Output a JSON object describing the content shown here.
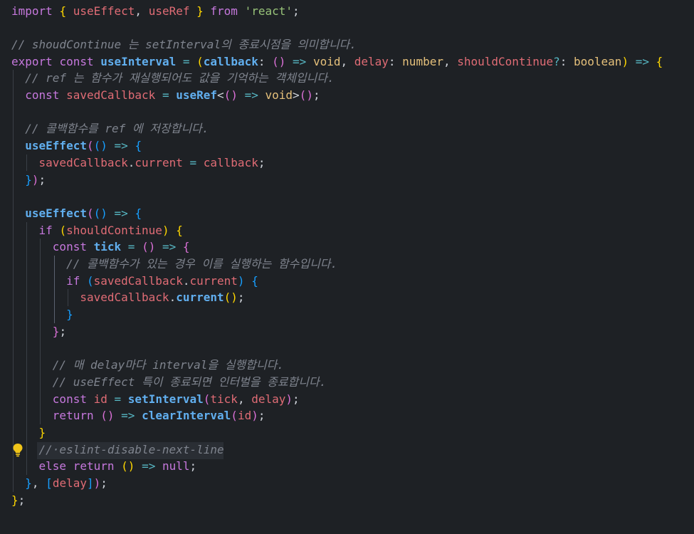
{
  "editor": {
    "colors": {
      "background": "#1e2125",
      "keyword": "#c678dd",
      "function": "#61afef",
      "variable": "#e06c75",
      "type": "#e5c07b",
      "string": "#98c379",
      "comment": "#7f848e",
      "bracket_1": "#ffd700",
      "bracket_2": "#da70d6",
      "bracket_3": "#179fff"
    },
    "lightbulb_icon": "lightbulb-icon",
    "lines": [
      [
        [
          "kw",
          "import"
        ],
        [
          "p",
          " "
        ],
        [
          "b1",
          "{"
        ],
        [
          "p",
          " "
        ],
        [
          "var",
          "useEffect"
        ],
        [
          "p",
          ", "
        ],
        [
          "var",
          "useRef"
        ],
        [
          "p",
          " "
        ],
        [
          "b1",
          "}"
        ],
        [
          "p",
          " "
        ],
        [
          "kw",
          "from"
        ],
        [
          "p",
          " "
        ],
        [
          "str",
          "'react'"
        ],
        [
          "p",
          ";"
        ]
      ],
      [],
      [
        [
          "com",
          "// shoudContinue 는 setInterval의 종료시점을 의미합니다."
        ]
      ],
      [
        [
          "kw",
          "export"
        ],
        [
          "p",
          " "
        ],
        [
          "kw",
          "const"
        ],
        [
          "p",
          " "
        ],
        [
          "fn",
          "useInterval"
        ],
        [
          "p",
          " "
        ],
        [
          "op",
          "="
        ],
        [
          "p",
          " "
        ],
        [
          "b1",
          "("
        ],
        [
          "fnp",
          "callback"
        ],
        [
          "p",
          ": "
        ],
        [
          "b2",
          "("
        ],
        [
          "b2",
          ")"
        ],
        [
          "p",
          " "
        ],
        [
          "op",
          "=>"
        ],
        [
          "p",
          " "
        ],
        [
          "type",
          "void"
        ],
        [
          "p",
          ", "
        ],
        [
          "var",
          "delay"
        ],
        [
          "p",
          ": "
        ],
        [
          "type",
          "number"
        ],
        [
          "p",
          ", "
        ],
        [
          "var",
          "shouldContinue"
        ],
        [
          "op",
          "?"
        ],
        [
          "p",
          ": "
        ],
        [
          "type",
          "boolean"
        ],
        [
          "b1",
          ")"
        ],
        [
          "p",
          " "
        ],
        [
          "op",
          "=>"
        ],
        [
          "p",
          " "
        ],
        [
          "b1",
          "{"
        ]
      ],
      [
        [
          "p",
          "  "
        ],
        [
          "com",
          "// ref 는 함수가 재실행되어도 값을 기억하는 객체입니다."
        ]
      ],
      [
        [
          "p",
          "  "
        ],
        [
          "kw",
          "const"
        ],
        [
          "p",
          " "
        ],
        [
          "var",
          "savedCallback"
        ],
        [
          "p",
          " "
        ],
        [
          "op",
          "="
        ],
        [
          "p",
          " "
        ],
        [
          "fn",
          "useRef"
        ],
        [
          "p",
          "<"
        ],
        [
          "b2",
          "("
        ],
        [
          "b2",
          ")"
        ],
        [
          "p",
          " "
        ],
        [
          "op",
          "=>"
        ],
        [
          "p",
          " "
        ],
        [
          "type",
          "void"
        ],
        [
          "p",
          ">"
        ],
        [
          "b2",
          "("
        ],
        [
          "b2",
          ")"
        ],
        [
          "p",
          ";"
        ]
      ],
      [],
      [
        [
          "p",
          "  "
        ],
        [
          "com",
          "// 콜백함수를 ref 에 저장합니다."
        ]
      ],
      [
        [
          "p",
          "  "
        ],
        [
          "fn",
          "useEffect"
        ],
        [
          "b2",
          "("
        ],
        [
          "b3",
          "("
        ],
        [
          "b3",
          ")"
        ],
        [
          "p",
          " "
        ],
        [
          "op",
          "=>"
        ],
        [
          "p",
          " "
        ],
        [
          "b3",
          "{"
        ]
      ],
      [
        [
          "p",
          "    "
        ],
        [
          "var",
          "savedCallback"
        ],
        [
          "p",
          "."
        ],
        [
          "var",
          "current"
        ],
        [
          "p",
          " "
        ],
        [
          "op",
          "="
        ],
        [
          "p",
          " "
        ],
        [
          "var",
          "callback"
        ],
        [
          "p",
          ";"
        ]
      ],
      [
        [
          "p",
          "  "
        ],
        [
          "b3",
          "}"
        ],
        [
          "b2",
          ")"
        ],
        [
          "p",
          ";"
        ]
      ],
      [],
      [
        [
          "p",
          "  "
        ],
        [
          "fn",
          "useEffect"
        ],
        [
          "b2",
          "("
        ],
        [
          "b3",
          "("
        ],
        [
          "b3",
          ")"
        ],
        [
          "p",
          " "
        ],
        [
          "op",
          "=>"
        ],
        [
          "p",
          " "
        ],
        [
          "b3",
          "{"
        ]
      ],
      [
        [
          "p",
          "    "
        ],
        [
          "kw",
          "if"
        ],
        [
          "p",
          " "
        ],
        [
          "b1",
          "("
        ],
        [
          "var",
          "shouldContinue"
        ],
        [
          "b1",
          ")"
        ],
        [
          "p",
          " "
        ],
        [
          "b1",
          "{"
        ]
      ],
      [
        [
          "p",
          "      "
        ],
        [
          "kw",
          "const"
        ],
        [
          "p",
          " "
        ],
        [
          "fn",
          "tick"
        ],
        [
          "p",
          " "
        ],
        [
          "op",
          "="
        ],
        [
          "p",
          " "
        ],
        [
          "b2",
          "("
        ],
        [
          "b2",
          ")"
        ],
        [
          "p",
          " "
        ],
        [
          "op",
          "=>"
        ],
        [
          "p",
          " "
        ],
        [
          "b2",
          "{"
        ]
      ],
      [
        [
          "p",
          "        "
        ],
        [
          "com",
          "// 콜백함수가 있는 경우 이를 실행하는 함수입니다."
        ]
      ],
      [
        [
          "p",
          "        "
        ],
        [
          "kw",
          "if"
        ],
        [
          "p",
          " "
        ],
        [
          "b3",
          "("
        ],
        [
          "var",
          "savedCallback"
        ],
        [
          "p",
          "."
        ],
        [
          "var",
          "current"
        ],
        [
          "b3",
          ")"
        ],
        [
          "p",
          " "
        ],
        [
          "b3",
          "{"
        ]
      ],
      [
        [
          "p",
          "          "
        ],
        [
          "var",
          "savedCallback"
        ],
        [
          "p",
          "."
        ],
        [
          "fn",
          "current"
        ],
        [
          "b1",
          "("
        ],
        [
          "b1",
          ")"
        ],
        [
          "p",
          ";"
        ]
      ],
      [
        [
          "p",
          "        "
        ],
        [
          "b3",
          "}"
        ]
      ],
      [
        [
          "p",
          "      "
        ],
        [
          "b2",
          "}"
        ],
        [
          "p",
          ";"
        ]
      ],
      [],
      [
        [
          "p",
          "      "
        ],
        [
          "com",
          "// 매 delay마다 interval을 실행합니다."
        ]
      ],
      [
        [
          "p",
          "      "
        ],
        [
          "com",
          "// useEffect 특이 종료되면 인터벌을 종료합니다."
        ]
      ],
      [
        [
          "p",
          "      "
        ],
        [
          "kw",
          "const"
        ],
        [
          "p",
          " "
        ],
        [
          "var",
          "id"
        ],
        [
          "p",
          " "
        ],
        [
          "op",
          "="
        ],
        [
          "p",
          " "
        ],
        [
          "fn",
          "setInterval"
        ],
        [
          "b2",
          "("
        ],
        [
          "var",
          "tick"
        ],
        [
          "p",
          ", "
        ],
        [
          "var",
          "delay"
        ],
        [
          "b2",
          ")"
        ],
        [
          "p",
          ";"
        ]
      ],
      [
        [
          "p",
          "      "
        ],
        [
          "kw",
          "return"
        ],
        [
          "p",
          " "
        ],
        [
          "b2",
          "("
        ],
        [
          "b2",
          ")"
        ],
        [
          "p",
          " "
        ],
        [
          "op",
          "=>"
        ],
        [
          "p",
          " "
        ],
        [
          "fn",
          "clearInterval"
        ],
        [
          "b2",
          "("
        ],
        [
          "var",
          "id"
        ],
        [
          "b2",
          ")"
        ],
        [
          "p",
          ";"
        ]
      ],
      [
        [
          "p",
          "    "
        ],
        [
          "b1",
          "}"
        ]
      ],
      [
        [
          "p",
          "    "
        ],
        [
          "com",
          "//·eslint-disable-next-line"
        ]
      ],
      [
        [
          "p",
          "    "
        ],
        [
          "kw",
          "else"
        ],
        [
          "p",
          " "
        ],
        [
          "kw",
          "return"
        ],
        [
          "p",
          " "
        ],
        [
          "b1",
          "("
        ],
        [
          "b1",
          ")"
        ],
        [
          "p",
          " "
        ],
        [
          "op",
          "=>"
        ],
        [
          "p",
          " "
        ],
        [
          "kw",
          "null"
        ],
        [
          "p",
          ";"
        ]
      ],
      [
        [
          "p",
          "  "
        ],
        [
          "b3",
          "}"
        ],
        [
          "p",
          ", "
        ],
        [
          "b3",
          "["
        ],
        [
          "var",
          "delay"
        ],
        [
          "b3",
          "]"
        ],
        [
          "b2",
          ")"
        ],
        [
          "p",
          ";"
        ]
      ],
      [
        [
          "b1",
          "}"
        ],
        [
          "p",
          ";"
        ]
      ]
    ]
  }
}
